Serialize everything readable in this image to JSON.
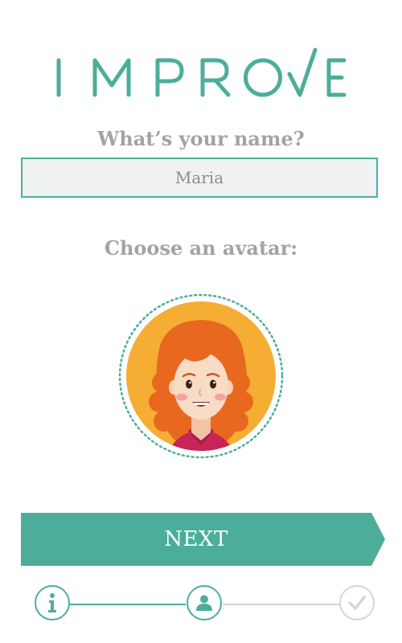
{
  "app": {
    "logo_text": "IMPROVE"
  },
  "colors": {
    "accent": "#4cae9a",
    "label_gray": "#a3a3a3",
    "inactive_gray": "#d6d6d6",
    "avatar_bg": "#f5ad33",
    "hair": "#e8681f",
    "shirt": "#c8245a"
  },
  "form": {
    "name_question": "What’s your name?",
    "name_value": "Maria",
    "avatar_question": "Choose an avatar:"
  },
  "avatar": {
    "icon": "girl-red-curly-hair-avatar"
  },
  "actions": {
    "next_label": "NEXT"
  },
  "stepper": {
    "steps": [
      {
        "icon": "info-icon",
        "state": "completed"
      },
      {
        "icon": "user-icon",
        "state": "current"
      },
      {
        "icon": "checkmark-icon",
        "state": "pending"
      }
    ]
  }
}
